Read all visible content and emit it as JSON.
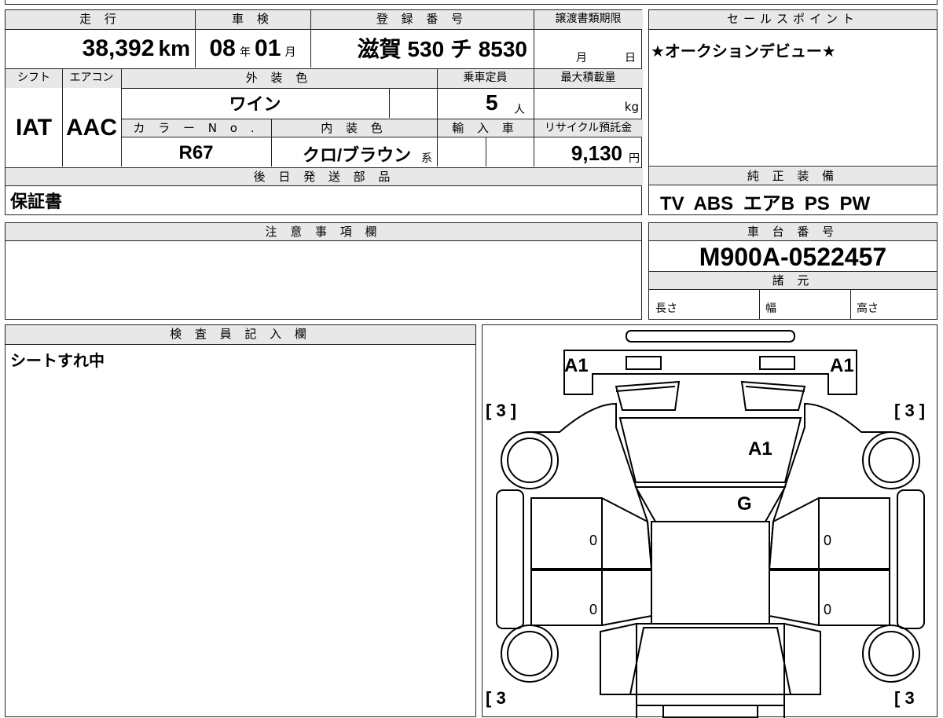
{
  "main_table": {
    "header_mileage": "走 行",
    "header_inspection": "車 検",
    "header_registration": "登 録 番 号",
    "header_transfer_deadline": "譲渡書類期限",
    "mileage_value": "38,392",
    "mileage_unit": "km",
    "inspection_year": "08",
    "inspection_year_unit": "年",
    "inspection_month": "01",
    "inspection_month_unit": "月",
    "registration_number": "滋賀 530 チ 8530",
    "transfer_month_unit": "月",
    "transfer_day_unit": "日",
    "header_shift": "シフト",
    "header_aircon": "エアコン",
    "header_exterior_color": "外 装 色",
    "header_capacity": "乗車定員",
    "header_max_load": "最大積載量",
    "exterior_color": "ワイン",
    "capacity_value": "5",
    "capacity_unit": "人",
    "max_load_unit": "kg",
    "shift_value": "IAT",
    "aircon_value": "AAC",
    "header_color_no": "カ ラ ー N o .",
    "header_interior_color": "内 装 色",
    "header_import": "輸 入 車",
    "header_recycle": "リサイクル預託金",
    "color_no": "R67",
    "interior_color": "クロ/ブラウン",
    "interior_suffix": "系",
    "recycle_value": "9,130",
    "recycle_unit": "円",
    "header_later_parts": "後 日 発 送 部 品",
    "later_parts_value": "保証書"
  },
  "sales_point": {
    "header": "セールスポイント",
    "text": "★オークションデビュー★"
  },
  "genuine_equipment": {
    "header": "純 正 装 備",
    "value": "TV ABS エアB PS PW"
  },
  "notes": {
    "header": "注 意 事 項 欄"
  },
  "chassis": {
    "header": "車 台 番 号",
    "value": "M900A-0522457"
  },
  "specs": {
    "header": "諸 元",
    "length_label": "長さ",
    "width_label": "幅",
    "height_label": "高さ"
  },
  "inspector": {
    "header": "検 査 員 記 入 欄",
    "text": "シートすれ中"
  },
  "diagram": {
    "labels": {
      "front_left": "A1",
      "front_right": "A1",
      "hood": "A1",
      "roof": "G",
      "left_front_fender": "[ 3 ]",
      "right_front_fender": "[ 3 ]",
      "left_rear": "[ 3",
      "right_rear": "[ 3",
      "door_fl": "0",
      "door_fr": "0",
      "door_rl": "0",
      "door_rr": "0"
    }
  }
}
